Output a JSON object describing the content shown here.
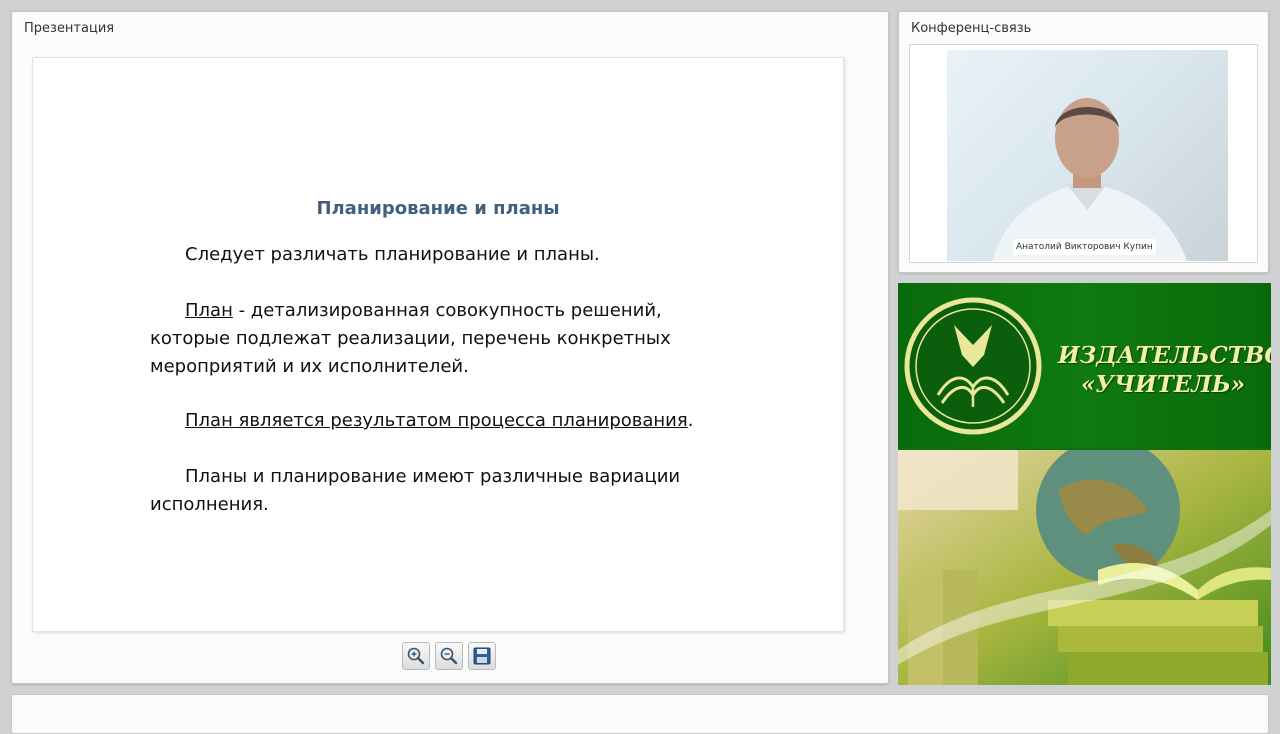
{
  "presentation_panel": {
    "title": "Презентация",
    "slide": {
      "title": "Планирование и планы",
      "p1": "Следует различать планирование и планы.",
      "p2_term": "План",
      "p2_rest": " - детализированная совокупность решений, которые подлежат реализации, перечень конкретных мероприятий и их исполнителей.",
      "p3_underlined": "План является результатом процесса планирования",
      "p3_tail": ".",
      "p4": "Планы и планирование имеют различные вариации исполнения."
    },
    "toolbar": [
      {
        "name": "zoom-in-button",
        "icon": "zoom-in-icon"
      },
      {
        "name": "zoom-out-button",
        "icon": "zoom-out-icon"
      },
      {
        "name": "save-button",
        "icon": "floppy-disk-icon"
      }
    ]
  },
  "conference_panel": {
    "title": "Конференц-связь",
    "speaker_name": "Анатолий Викторович Купин"
  },
  "banner": {
    "publisher_line1": "ИЗДАТЕЛЬСТВО",
    "publisher_line2": "«УЧИТЕЛЬ»",
    "colors": {
      "green": "#0f7a10",
      "gold": "#f1f0a6"
    }
  }
}
